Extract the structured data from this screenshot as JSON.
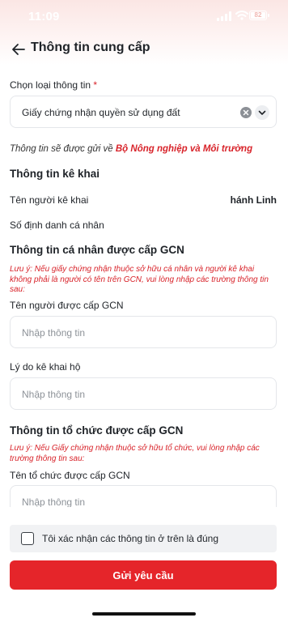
{
  "status_bar": {
    "time": "11:09",
    "battery": "82"
  },
  "header": {
    "title": "Thông tin cung cấp"
  },
  "form": {
    "info_type": {
      "label": "Chọn loại thông tin",
      "required_mark": "*",
      "value": "Giấy chứng nhận quyền sử dụng đất"
    },
    "notice_prefix": "Thông tin sẽ được gửi về",
    "notice_org": "Bộ Nông nghiệp và Môi trường",
    "declarant": {
      "title": "Thông tin kê khai",
      "name_label": "Tên người kê khai",
      "name_value": "hánh Linh",
      "id_label": "Số định danh cá nhân"
    },
    "individual": {
      "title": "Thông tin cá nhân được cấp GCN",
      "note": "Lưu ý: Nếu giấy chứng nhận thuộc sở hữu cá nhân và người kê khai không phải là người có tên trên GCN, vui lòng nhập các trường thông tin sau:",
      "name_label": "Tên người được cấp GCN",
      "name_placeholder": "Nhập thông tin",
      "reason_label": "Lý do kê khai hộ",
      "reason_placeholder": "Nhập thông tin"
    },
    "organization": {
      "title": "Thông tin tổ chức được cấp GCN",
      "note": "Lưu ý: Nếu Giấy chứng nhận thuộc sở hữu tổ chức, vui lòng nhập các trường thông tin sau:",
      "name_label": "Tên tổ chức được cấp GCN",
      "name_placeholder": "Nhập thông tin"
    }
  },
  "footer": {
    "confirm_text": "Tôi xác nhận các thông tin ở trên là đúng",
    "submit_label": "Gửi yêu cầu"
  },
  "colors": {
    "accent": "#e5252a",
    "required": "#d8232a",
    "header_tint": "#fbe6e4"
  }
}
